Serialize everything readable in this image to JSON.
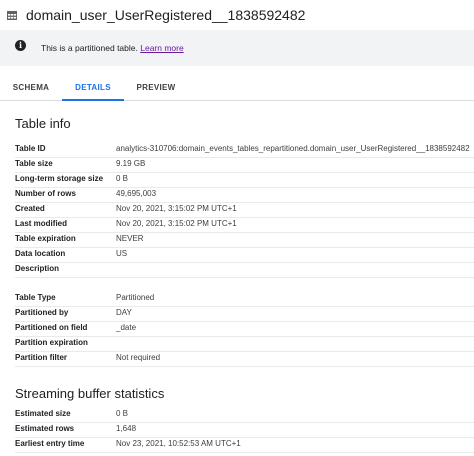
{
  "header": {
    "title": "domain_user_UserRegistered__1838592482",
    "icon": "table-icon"
  },
  "banner": {
    "text": "This is a partitioned table.",
    "link": "Learn more",
    "icon": "info-icon"
  },
  "tabs": [
    {
      "label": "SCHEMA",
      "active": false
    },
    {
      "label": "DETAILS",
      "active": true
    },
    {
      "label": "PREVIEW",
      "active": false
    }
  ],
  "table_info": {
    "title": "Table info",
    "rows": [
      {
        "label": "Table ID",
        "value": "analytics-310706:domain_events_tables_repartitioned.domain_user_UserRegistered__1838592482"
      },
      {
        "label": "Table size",
        "value": "9.19 GB"
      },
      {
        "label": "Long-term storage size",
        "value": "0 B"
      },
      {
        "label": "Number of rows",
        "value": "49,695,003"
      },
      {
        "label": "Created",
        "value": "Nov 20, 2021, 3:15:02 PM UTC+1"
      },
      {
        "label": "Last modified",
        "value": "Nov 20, 2021, 3:15:02 PM UTC+1"
      },
      {
        "label": "Table expiration",
        "value": "NEVER"
      },
      {
        "label": "Data location",
        "value": "US"
      },
      {
        "label": "Description",
        "value": ""
      }
    ]
  },
  "partition_info": {
    "rows": [
      {
        "label": "Table Type",
        "value": "Partitioned"
      },
      {
        "label": "Partitioned by",
        "value": "DAY"
      },
      {
        "label": "Partitioned on field",
        "value": "_date"
      },
      {
        "label": "Partition expiration",
        "value": ""
      },
      {
        "label": "Partition filter",
        "value": "Not required"
      }
    ]
  },
  "streaming": {
    "title": "Streaming buffer statistics",
    "rows": [
      {
        "label": "Estimated size",
        "value": "0 B"
      },
      {
        "label": "Estimated rows",
        "value": "1,648"
      },
      {
        "label": "Earliest entry time",
        "value": "Nov 23, 2021, 10:52:53 AM UTC+1"
      }
    ]
  },
  "colors": {
    "accent": "#1a73e8",
    "banner_bg": "#f1f3f4",
    "link": "#6a1b9a",
    "divider": "#e8eaed"
  }
}
